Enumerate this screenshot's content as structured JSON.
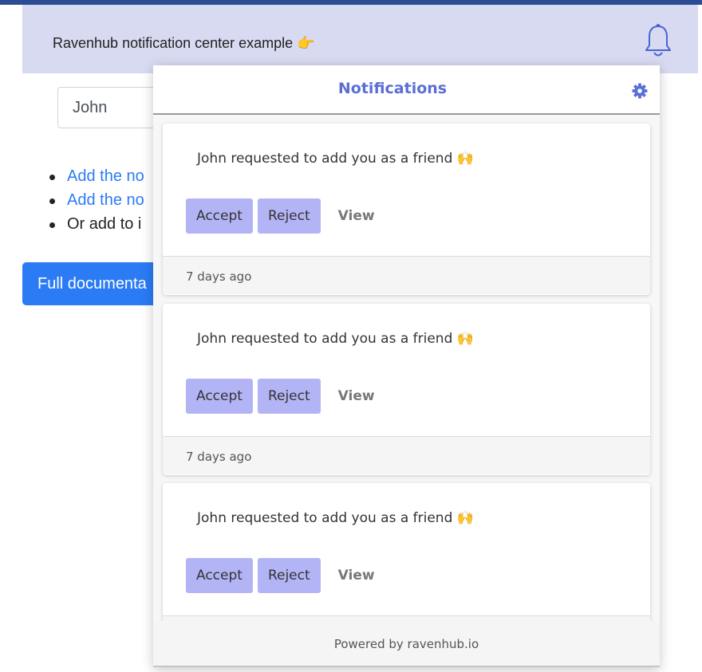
{
  "header": {
    "title": "Ravenhub notification center example 👉",
    "bell_icon": "bell-icon"
  },
  "form": {
    "name_value": "John"
  },
  "links": [
    {
      "text": "Add the no",
      "is_link": true
    },
    {
      "text": "Add the no",
      "is_link": true
    },
    {
      "text": "Or add to i",
      "is_link": false
    }
  ],
  "doc_button": {
    "label": "Full documenta"
  },
  "notifications": {
    "title": "Notifications",
    "settings_icon": "gear-icon",
    "items": [
      {
        "message": "John requested to add you as a friend 🙌",
        "accept_label": "Accept",
        "reject_label": "Reject",
        "view_label": "View",
        "time": "7 days ago"
      },
      {
        "message": "John requested to add you as a friend 🙌",
        "accept_label": "Accept",
        "reject_label": "Reject",
        "view_label": "View",
        "time": "7 days ago"
      },
      {
        "message": "John requested to add you as a friend 🙌",
        "accept_label": "Accept",
        "reject_label": "Reject",
        "view_label": "View",
        "time": ""
      }
    ],
    "footer": "Powered by ravenhub.io"
  },
  "colors": {
    "accent": "#5a6fd6",
    "header_bg": "#d7daf0",
    "button_bg": "#b3b4f5",
    "primary_blue": "#2b7bf5"
  }
}
